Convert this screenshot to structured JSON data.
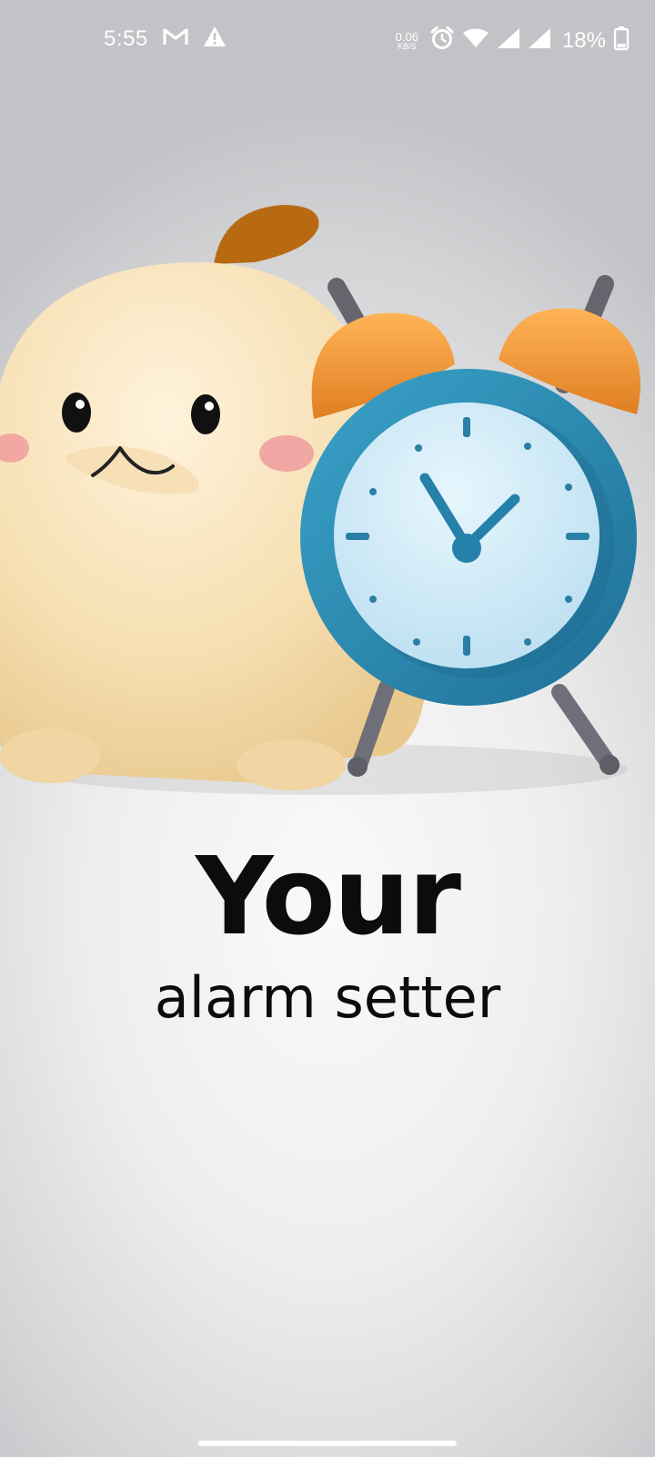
{
  "status_bar": {
    "time": "5:55",
    "notification_icons": [
      "gmail-icon",
      "warning-icon"
    ],
    "network_speed": {
      "value": "0.06",
      "unit": "KB/S"
    },
    "system_icons": [
      "alarm-icon",
      "wifi-icon",
      "signal-icon",
      "signal-icon"
    ],
    "battery_percent": "18%"
  },
  "hero": {
    "illustration": "mascot-with-alarm-clock",
    "title": "Your",
    "subtitle": "alarm setter"
  },
  "colors": {
    "clock_body": "#2e8db5",
    "clock_face": "#cfeaf7",
    "clock_bells": "#f39a3c",
    "mascot_body": "#f8e2b8",
    "mascot_cheeks": "#f2a8a8",
    "text": "#0c0c0c"
  }
}
